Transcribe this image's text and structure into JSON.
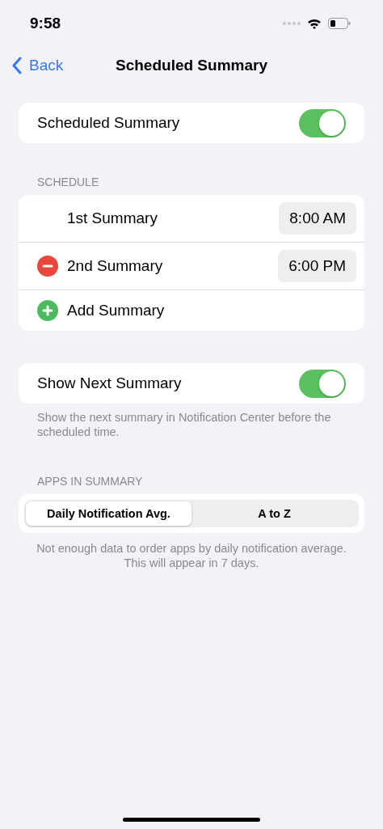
{
  "status_bar": {
    "time": "9:58"
  },
  "nav": {
    "back": "Back",
    "title": "Scheduled Summary"
  },
  "main_toggle": {
    "label": "Scheduled Summary",
    "on": true
  },
  "schedule": {
    "header": "SCHEDULE",
    "rows": [
      {
        "kind": "fixed",
        "label": "1st Summary",
        "time": "8:00 AM"
      },
      {
        "kind": "removable",
        "label": "2nd Summary",
        "time": "6:00 PM"
      },
      {
        "kind": "add",
        "label": "Add Summary"
      }
    ]
  },
  "next_toggle": {
    "label": "Show Next Summary",
    "on": true,
    "footer": "Show the next summary in Notification Center before the scheduled time."
  },
  "apps": {
    "header": "APPS IN SUMMARY",
    "segments": [
      {
        "label": "Daily Notification Avg.",
        "selected": true
      },
      {
        "label": "A to Z",
        "selected": false
      }
    ],
    "footer": "Not enough data to order apps by daily notification average. This will appear in 7 days."
  }
}
